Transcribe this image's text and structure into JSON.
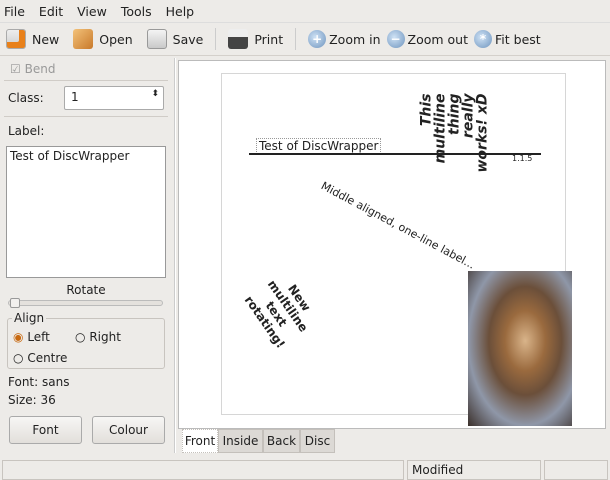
{
  "menubar": {
    "items": [
      "File",
      "Edit",
      "View",
      "Tools",
      "Help"
    ]
  },
  "toolbar": {
    "new": "New",
    "open": "Open",
    "save": "Save",
    "print": "Print",
    "zoom_in": "Zoom in",
    "zoom_out": "Zoom out",
    "fit_best": "Fit best"
  },
  "left": {
    "bend": "Bend",
    "class_label": "Class:",
    "class_value": "1",
    "label_label": "Label:",
    "label_text": "Test of DiscWrapper",
    "rotate": "Rotate",
    "rotate_value": 0,
    "align": "Align",
    "left": "Left",
    "right": "Right",
    "centre": "Centre",
    "align_selected": "Left",
    "font": "Font: sans",
    "size": "Size: 36",
    "font_btn": "Font",
    "colour_btn": "Colour"
  },
  "canvas": {
    "title_text": "Test of DiscWrapper",
    "vertical_lines": [
      "This",
      "multiline",
      "thing",
      "really",
      "works! xD"
    ],
    "version": "1.1.5",
    "middle": "Middle aligned, one-line label...",
    "rotating_lines": [
      "New",
      "multiline",
      "text",
      "rotating!"
    ]
  },
  "tabs": [
    "Front",
    "Inside",
    "Back",
    "Disc"
  ],
  "status": {
    "text": "",
    "modified": "Modified"
  }
}
